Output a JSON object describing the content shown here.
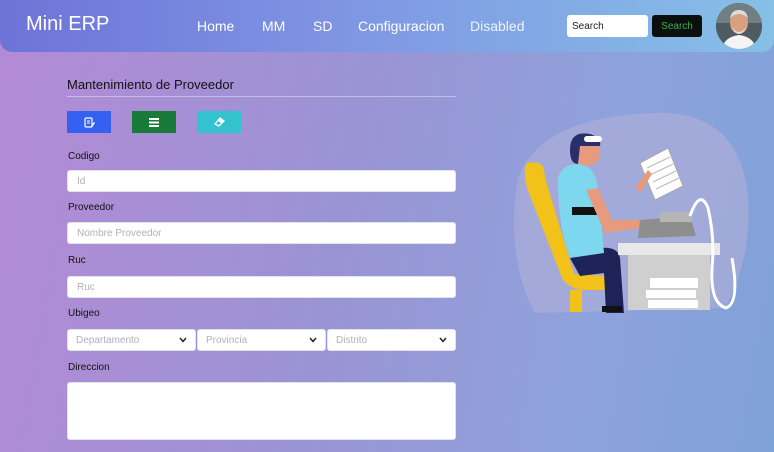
{
  "navbar": {
    "brand": "Mini ERP",
    "links": [
      {
        "label": "Home"
      },
      {
        "label": "MM"
      },
      {
        "label": "SD"
      },
      {
        "label": "Configuracion"
      },
      {
        "label": "Disabled"
      }
    ],
    "search_placeholder": "Search",
    "search_button": "Search"
  },
  "form": {
    "title": "Mantenimiento de Proveedor",
    "toolbar": [
      {
        "icon": "document-edit-icon",
        "color": "#3461f2"
      },
      {
        "icon": "list-icon",
        "color": "#177a38"
      },
      {
        "icon": "eraser-icon",
        "color": "#32c3cf"
      }
    ],
    "codigo": {
      "label": "Codigo",
      "placeholder": "Id",
      "value": ""
    },
    "proveedor": {
      "label": "Proveedor",
      "placeholder": "Nombre Proveedor",
      "value": ""
    },
    "ruc": {
      "label": "Ruc",
      "placeholder": "Ruc",
      "value": ""
    },
    "ubigeo": {
      "label": "Ubigeo",
      "departamento": "Departamento",
      "provincia": "Provincia",
      "distrito": "Distrito"
    },
    "direccion": {
      "label": "Direccion",
      "value": ""
    }
  },
  "colors": {
    "accent_blue": "#3461f2",
    "accent_green": "#177a38",
    "accent_cyan": "#32c3cf",
    "search_button_bg": "#0b0f0d"
  },
  "illustration": {
    "icon": "person-typing-illustration"
  }
}
